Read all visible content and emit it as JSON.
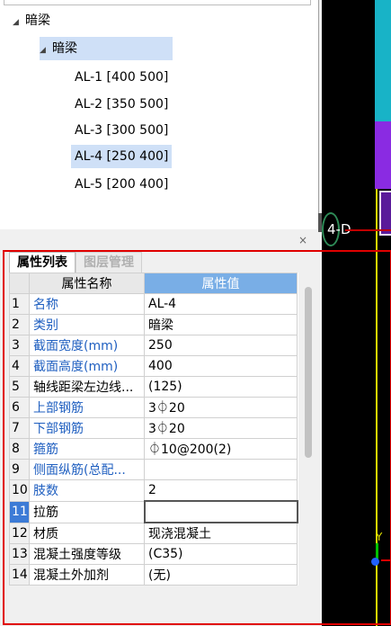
{
  "tree": {
    "search_placeholder": "",
    "root": {
      "label": "暗梁"
    },
    "child": {
      "label": "暗梁"
    },
    "leaves": [
      "AL-1 [400 500]",
      "AL-2 [350 500]",
      "AL-3 [300 500]",
      "AL-4 [250 400]",
      "AL-5 [200 400]"
    ],
    "selected_index": 3
  },
  "props": {
    "close": "×",
    "tabs": [
      "属性列表",
      "图层管理"
    ],
    "headers": {
      "name": "属性名称",
      "value": "属性值"
    },
    "rows": [
      {
        "num": "1",
        "name": "名称",
        "value": "AL-4"
      },
      {
        "num": "2",
        "name": "类别",
        "value": "暗梁"
      },
      {
        "num": "3",
        "name": "截面宽度(mm)",
        "value": "250"
      },
      {
        "num": "4",
        "name": "截面高度(mm)",
        "value": "400"
      },
      {
        "num": "5",
        "name": "轴线距梁左边线...",
        "value": "(125)"
      },
      {
        "num": "6",
        "name": "上部钢筋",
        "value": "3⏀20"
      },
      {
        "num": "7",
        "name": "下部钢筋",
        "value": "3⏀20"
      },
      {
        "num": "8",
        "name": "箍筋",
        "value": "⏀10@200(2)"
      },
      {
        "num": "9",
        "name": "侧面纵筋(总配...",
        "value": ""
      },
      {
        "num": "10",
        "name": "肢数",
        "value": "2"
      },
      {
        "num": "11",
        "name": "拉筋",
        "value": ""
      },
      {
        "num": "12",
        "name": "材质",
        "value": "现浇混凝土"
      },
      {
        "num": "13",
        "name": "混凝土强度等级",
        "value": "(C35)"
      },
      {
        "num": "14",
        "name": "混凝土外加剂",
        "value": "(无)"
      }
    ]
  },
  "canvas": {
    "axis_label": "4-D",
    "y_label": "Y"
  },
  "colors": {
    "accent": "#79aee6",
    "selection": "#e00000",
    "link_text": "#1f5fc0"
  }
}
